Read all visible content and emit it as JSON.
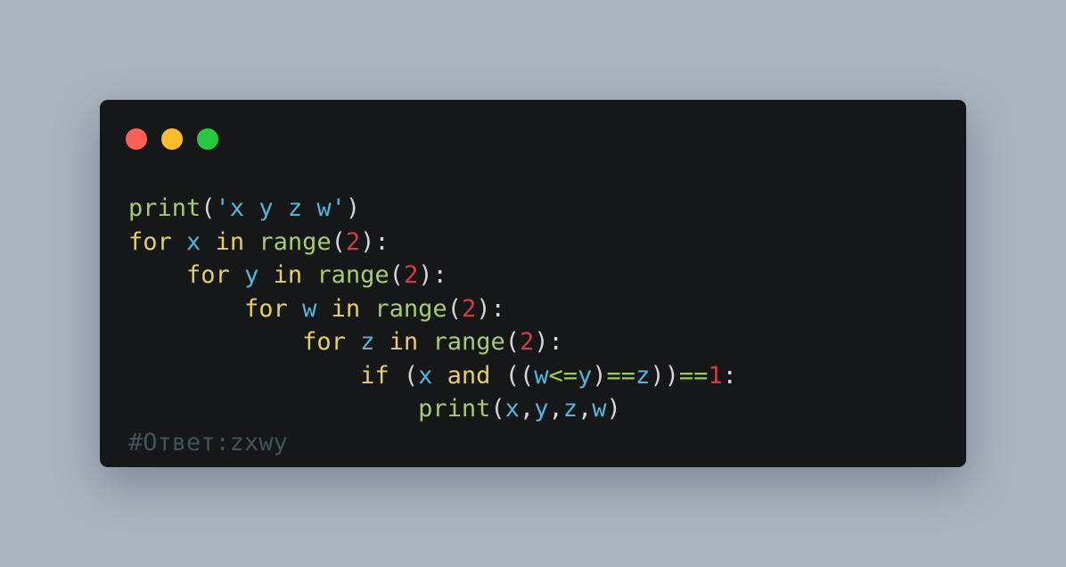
{
  "window": {
    "controls": [
      {
        "name": "close",
        "color": "#ff5f57"
      },
      {
        "name": "minimize",
        "color": "#febc2e"
      },
      {
        "name": "zoom",
        "color": "#28c840"
      }
    ]
  },
  "colors": {
    "function": "#a6cc70",
    "keyword": "#e6cd69",
    "variable": "#55b5db",
    "number": "#cd3f45",
    "string": "#55b5db",
    "operator": "#9fca56",
    "punct": "#d4d7d6",
    "comment": "#41535b"
  },
  "code": {
    "lines": [
      [
        {
          "t": "print",
          "c": "function"
        },
        {
          "t": "(",
          "c": "punct"
        },
        {
          "t": "'x y z w'",
          "c": "string"
        },
        {
          "t": ")",
          "c": "punct"
        }
      ],
      [
        {
          "t": "for",
          "c": "keyword"
        },
        {
          "t": " ",
          "c": "punct"
        },
        {
          "t": "x",
          "c": "variable"
        },
        {
          "t": " ",
          "c": "punct"
        },
        {
          "t": "in",
          "c": "keyword"
        },
        {
          "t": " ",
          "c": "punct"
        },
        {
          "t": "range",
          "c": "function"
        },
        {
          "t": "(",
          "c": "punct"
        },
        {
          "t": "2",
          "c": "number"
        },
        {
          "t": "):",
          "c": "punct"
        }
      ],
      [
        {
          "t": "    ",
          "c": "punct"
        },
        {
          "t": "for",
          "c": "keyword"
        },
        {
          "t": " ",
          "c": "punct"
        },
        {
          "t": "y",
          "c": "variable"
        },
        {
          "t": " ",
          "c": "punct"
        },
        {
          "t": "in",
          "c": "keyword"
        },
        {
          "t": " ",
          "c": "punct"
        },
        {
          "t": "range",
          "c": "function"
        },
        {
          "t": "(",
          "c": "punct"
        },
        {
          "t": "2",
          "c": "number"
        },
        {
          "t": "):",
          "c": "punct"
        }
      ],
      [
        {
          "t": "        ",
          "c": "punct"
        },
        {
          "t": "for",
          "c": "keyword"
        },
        {
          "t": " ",
          "c": "punct"
        },
        {
          "t": "w",
          "c": "variable"
        },
        {
          "t": " ",
          "c": "punct"
        },
        {
          "t": "in",
          "c": "keyword"
        },
        {
          "t": " ",
          "c": "punct"
        },
        {
          "t": "range",
          "c": "function"
        },
        {
          "t": "(",
          "c": "punct"
        },
        {
          "t": "2",
          "c": "number"
        },
        {
          "t": "):",
          "c": "punct"
        }
      ],
      [
        {
          "t": "            ",
          "c": "punct"
        },
        {
          "t": "for",
          "c": "keyword"
        },
        {
          "t": " ",
          "c": "punct"
        },
        {
          "t": "z",
          "c": "variable"
        },
        {
          "t": " ",
          "c": "punct"
        },
        {
          "t": "in",
          "c": "keyword"
        },
        {
          "t": " ",
          "c": "punct"
        },
        {
          "t": "range",
          "c": "function"
        },
        {
          "t": "(",
          "c": "punct"
        },
        {
          "t": "2",
          "c": "number"
        },
        {
          "t": "):",
          "c": "punct"
        }
      ],
      [
        {
          "t": "                ",
          "c": "punct"
        },
        {
          "t": "if",
          "c": "keyword"
        },
        {
          "t": " (",
          "c": "punct"
        },
        {
          "t": "x",
          "c": "variable"
        },
        {
          "t": " ",
          "c": "punct"
        },
        {
          "t": "and",
          "c": "keyword"
        },
        {
          "t": " ((",
          "c": "punct"
        },
        {
          "t": "w",
          "c": "variable"
        },
        {
          "t": "<=",
          "c": "operator"
        },
        {
          "t": "y",
          "c": "variable"
        },
        {
          "t": ")",
          "c": "punct"
        },
        {
          "t": "==",
          "c": "operator"
        },
        {
          "t": "z",
          "c": "variable"
        },
        {
          "t": "))",
          "c": "punct"
        },
        {
          "t": "==",
          "c": "operator"
        },
        {
          "t": "1",
          "c": "number"
        },
        {
          "t": ":",
          "c": "punct"
        }
      ],
      [
        {
          "t": "                    ",
          "c": "punct"
        },
        {
          "t": "print",
          "c": "function"
        },
        {
          "t": "(",
          "c": "punct"
        },
        {
          "t": "x",
          "c": "variable"
        },
        {
          "t": ",",
          "c": "punct"
        },
        {
          "t": "y",
          "c": "variable"
        },
        {
          "t": ",",
          "c": "punct"
        },
        {
          "t": "z",
          "c": "variable"
        },
        {
          "t": ",",
          "c": "punct"
        },
        {
          "t": "w",
          "c": "variable"
        },
        {
          "t": ")",
          "c": "punct"
        }
      ],
      [
        {
          "t": "#Ответ:zxwy",
          "c": "comment"
        }
      ]
    ]
  }
}
